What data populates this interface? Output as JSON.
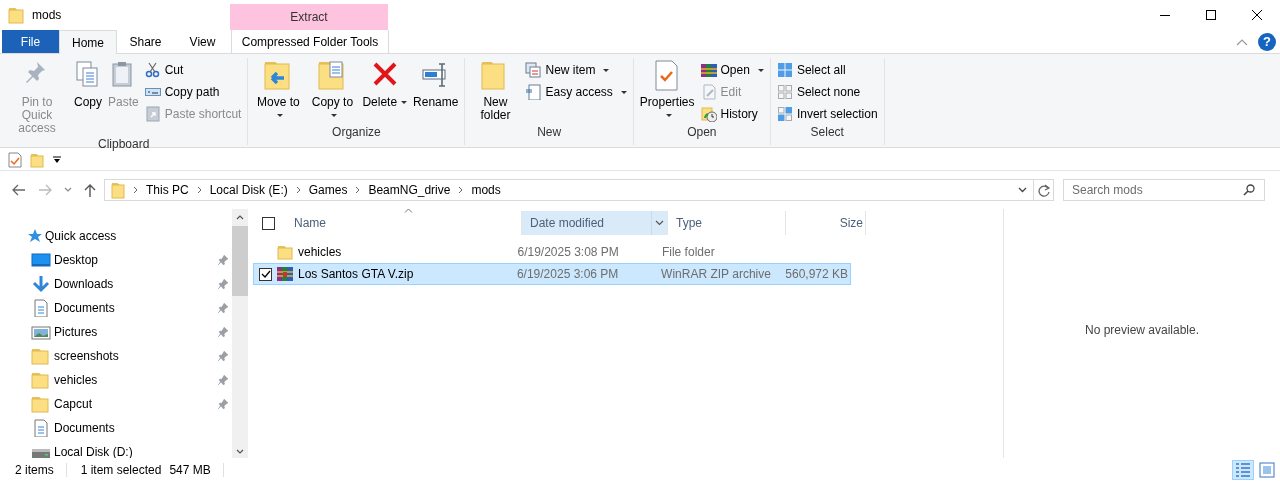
{
  "window": {
    "title": "mods"
  },
  "context_tab_group": {
    "label": "Extract"
  },
  "ribbon_tabs": [
    {
      "label": "File",
      "kind": "file",
      "selected": false
    },
    {
      "label": "Home",
      "kind": "tab",
      "selected": true
    },
    {
      "label": "Share",
      "kind": "tab",
      "selected": false
    },
    {
      "label": "View",
      "kind": "tab",
      "selected": false
    },
    {
      "label": "Compressed Folder Tools",
      "kind": "contextual",
      "selected": false
    }
  ],
  "help_button": "?",
  "ribbon_groups": [
    {
      "label": "Clipboard",
      "buttons": [
        {
          "label": "Pin to Quick access",
          "kind": "large",
          "disabled": true,
          "dropdown": false
        },
        {
          "label": "Copy",
          "kind": "large",
          "disabled": false,
          "dropdown": false
        },
        {
          "label": "Paste",
          "kind": "large",
          "disabled": true,
          "dropdown": false
        },
        {
          "label": "Cut",
          "kind": "small",
          "disabled": false,
          "dropdown": false
        },
        {
          "label": "Copy path",
          "kind": "small",
          "disabled": false,
          "dropdown": false
        },
        {
          "label": "Paste shortcut",
          "kind": "small",
          "disabled": true,
          "dropdown": false
        }
      ]
    },
    {
      "label": "Organize",
      "buttons": [
        {
          "label": "Move to",
          "kind": "large",
          "disabled": false,
          "dropdown": true
        },
        {
          "label": "Copy to",
          "kind": "large",
          "disabled": false,
          "dropdown": true
        },
        {
          "label": "Delete",
          "kind": "large",
          "disabled": false,
          "dropdown": true
        },
        {
          "label": "Rename",
          "kind": "large",
          "disabled": false,
          "dropdown": false
        }
      ]
    },
    {
      "label": "New",
      "buttons": [
        {
          "label": "New folder",
          "kind": "large",
          "disabled": false,
          "dropdown": false
        },
        {
          "label": "New item",
          "kind": "small",
          "disabled": false,
          "dropdown": true
        },
        {
          "label": "Easy access",
          "kind": "small",
          "disabled": false,
          "dropdown": true
        }
      ]
    },
    {
      "label": "Open",
      "buttons": [
        {
          "label": "Properties",
          "kind": "large",
          "disabled": false,
          "dropdown": true
        },
        {
          "label": "Open",
          "kind": "small",
          "disabled": false,
          "dropdown": true
        },
        {
          "label": "Edit",
          "kind": "small",
          "disabled": true,
          "dropdown": false
        },
        {
          "label": "History",
          "kind": "small",
          "disabled": false,
          "dropdown": false
        }
      ]
    },
    {
      "label": "Select",
      "buttons": [
        {
          "label": "Select all",
          "kind": "small",
          "disabled": false,
          "dropdown": false
        },
        {
          "label": "Select none",
          "kind": "small",
          "disabled": false,
          "dropdown": false
        },
        {
          "label": "Invert selection",
          "kind": "small",
          "disabled": false,
          "dropdown": false
        }
      ]
    }
  ],
  "breadcrumb": [
    "This PC",
    "Local Disk (E:)",
    "Games",
    "BeamNG_drive",
    "mods"
  ],
  "search": {
    "placeholder": "Search mods"
  },
  "navigation": {
    "header": "Quick access",
    "items": [
      {
        "label": "Desktop",
        "kind": "desktop",
        "pinned": true
      },
      {
        "label": "Downloads",
        "kind": "downloads",
        "pinned": true
      },
      {
        "label": "Documents",
        "kind": "documents",
        "pinned": true
      },
      {
        "label": "Pictures",
        "kind": "pictures",
        "pinned": true
      },
      {
        "label": "screenshots",
        "kind": "folder",
        "pinned": true
      },
      {
        "label": "vehicles",
        "kind": "folder",
        "pinned": true
      },
      {
        "label": "Capcut",
        "kind": "folder",
        "pinned": true
      },
      {
        "label": "Documents",
        "kind": "documents",
        "pinned": false
      },
      {
        "label": "Local Disk (D:)",
        "kind": "drive",
        "pinned": false
      }
    ]
  },
  "file_list": {
    "select_all_checked": false,
    "columns": [
      {
        "label": "Name",
        "sorted": true,
        "hovered": false
      },
      {
        "label": "Date modified",
        "sorted": false,
        "hovered": true
      },
      {
        "label": "Type",
        "sorted": false,
        "hovered": false
      },
      {
        "label": "Size",
        "sorted": false,
        "hovered": false
      }
    ],
    "rows": [
      {
        "name": "vehicles",
        "date": "6/19/2025 3:08 PM",
        "type": "File folder",
        "size": "",
        "kind": "folder",
        "selected": false,
        "checked": false
      },
      {
        "name": "Los Santos GTA V.zip",
        "date": "6/19/2025 3:06 PM",
        "type": "WinRAR ZIP archive",
        "size": "560,972 KB",
        "kind": "archive",
        "selected": true,
        "checked": true
      }
    ]
  },
  "preview": {
    "message": "No preview available."
  },
  "status_bar": {
    "item_count": "2 items",
    "selection": "1 item selected",
    "selection_size": "547 MB",
    "view_buttons": [
      {
        "selected": true
      },
      {
        "selected": false
      }
    ]
  }
}
